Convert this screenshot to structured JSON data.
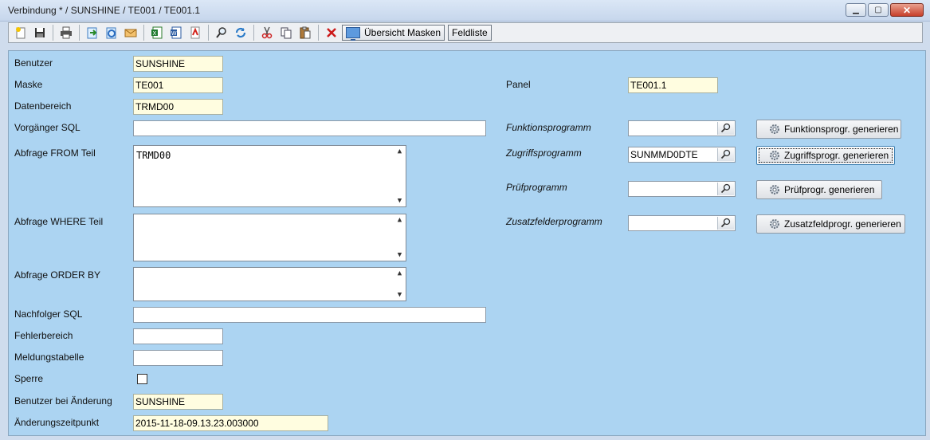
{
  "window": {
    "title": "Verbindung * / SUNSHINE / TE001 / TE001.1",
    "minimize": "▁",
    "maximize": "▢",
    "close": "✕"
  },
  "toolbar": {
    "icons": [
      "new-icon",
      "save-icon",
      "print-icon",
      "export-icon",
      "import-icon",
      "mail-icon",
      "excel-icon",
      "word-icon",
      "pdf-icon",
      "search-icon",
      "refresh-icon",
      "cut-icon",
      "copy-icon",
      "paste-icon",
      "delete-icon"
    ],
    "uebersicht_label": "Übersicht Masken",
    "feldliste_label": "Feldliste"
  },
  "form": {
    "benutzer": {
      "label": "Benutzer",
      "value": "SUNSHINE"
    },
    "maske": {
      "label": "Maske",
      "value": "TE001"
    },
    "datenbereich": {
      "label": "Datenbereich",
      "value": "TRMD00"
    },
    "vorgaenger_sql": {
      "label": "Vorgänger SQL",
      "value": ""
    },
    "abfrage_from": {
      "label": "Abfrage FROM Teil",
      "value": "TRMD00"
    },
    "abfrage_where": {
      "label": "Abfrage WHERE Teil",
      "value": ""
    },
    "abfrage_order": {
      "label": "Abfrage ORDER BY",
      "value": ""
    },
    "nachfolger_sql": {
      "label": "Nachfolger SQL",
      "value": ""
    },
    "fehlerbereich": {
      "label": "Fehlerbereich",
      "value": ""
    },
    "meldungstabelle": {
      "label": "Meldungstabelle",
      "value": ""
    },
    "sperre": {
      "label": "Sperre",
      "checked": false
    },
    "benutzer_aenderung": {
      "label": "Benutzer bei Änderung",
      "value": "SUNSHINE"
    },
    "aenderungszeitpunkt": {
      "label": "Änderungszeitpunkt",
      "value": "2015-11-18-09.13.23.003000"
    },
    "panel": {
      "label": "Panel",
      "value": "TE001.1"
    },
    "funktionsprogramm": {
      "label": "Funktionsprogramm",
      "value": "",
      "button": "Funktionsprogr. generieren"
    },
    "zugriffsprogramm": {
      "label": "Zugriffsprogramm",
      "value": "SUNMMD0DTE",
      "button": "Zugriffsprogr. generieren"
    },
    "pruefprogramm": {
      "label": "Prüfprogramm",
      "value": "",
      "button": "Prüfprogr. generieren"
    },
    "zusatzfelderprogramm": {
      "label": "Zusatzfelderprogramm",
      "value": "",
      "button": "Zusatzfeldprogr. generieren"
    }
  },
  "colors": {
    "panel": "#acd4f2",
    "readonly": "#fffde0",
    "titlebar": "#c6d6ec"
  }
}
